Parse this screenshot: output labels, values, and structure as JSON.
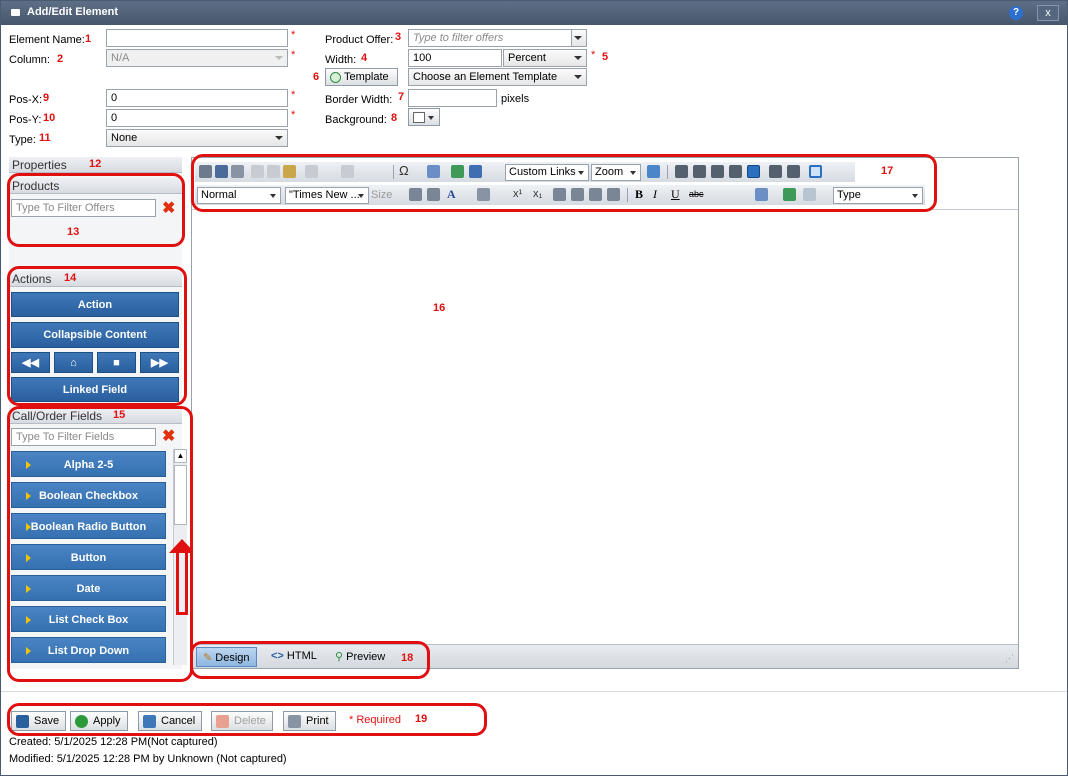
{
  "window": {
    "title": "Add/Edit Element",
    "help_label": "?",
    "close_label": "x"
  },
  "form": {
    "element_name_label": "Element Name:",
    "column_label": "Column:",
    "column_value": "N/A",
    "pos_x_label": "Pos-X:",
    "pos_x_value": "0",
    "pos_y_label": "Pos-Y:",
    "pos_y_value": "0",
    "type_label": "Type:",
    "type_value": "None",
    "product_offer_label": "Product Offer:",
    "product_offer_placeholder": "Type to filter offers",
    "width_label": "Width:",
    "width_value": "100",
    "width_unit": "Percent",
    "template_button": "Template",
    "template_select": "Choose an Element Template",
    "border_width_label": "Border Width:",
    "border_width_unit": "pixels",
    "background_label": "Background:",
    "required_mark": "*"
  },
  "annotations": {
    "n1": "1",
    "n2": "2",
    "n3": "3",
    "n4": "4",
    "n5": "5",
    "n6": "6",
    "n7": "7",
    "n8": "8",
    "n9": "9",
    "n10": "10",
    "n11": "11",
    "n12": "12",
    "n13": "13",
    "n14": "14",
    "n15": "15",
    "n16": "16",
    "n17": "17",
    "n18": "18",
    "n19": "19"
  },
  "left": {
    "properties_label": "Properties",
    "products_label": "Products",
    "products_filter_placeholder": "Type To Filter Offers",
    "actions_label": "Actions",
    "action_button": "Action",
    "collapsible_button": "Collapsible Content",
    "linked_field_button": "Linked Field",
    "call_order_label": "Call/Order Fields",
    "fields_filter_placeholder": "Type To Filter Fields",
    "fields": [
      "Alpha 2-5",
      "Boolean Checkbox",
      "Boolean Radio Button",
      "Button",
      "Date",
      "List Check Box",
      "List Drop Down"
    ]
  },
  "editor": {
    "custom_links": "Custom Links",
    "zoom": "Zoom",
    "format": "Normal",
    "font": "\"Times New ...",
    "size": "Size",
    "type": "Type",
    "tab_design": "Design",
    "tab_html": "HTML",
    "tab_preview": "Preview"
  },
  "footer": {
    "save": "Save",
    "apply": "Apply",
    "cancel": "Cancel",
    "delete": "Delete",
    "print": "Print",
    "required_note": "* Required",
    "created": "Created:  5/1/2025 12:28 PM(Not captured)",
    "modified": "Modified:  5/1/2025 12:28 PM by Unknown (Not captured)"
  },
  "colors": {
    "accent_blue": "#2a5f9e",
    "annotation_red": "#e01010",
    "title_bar": "#4f6178"
  }
}
